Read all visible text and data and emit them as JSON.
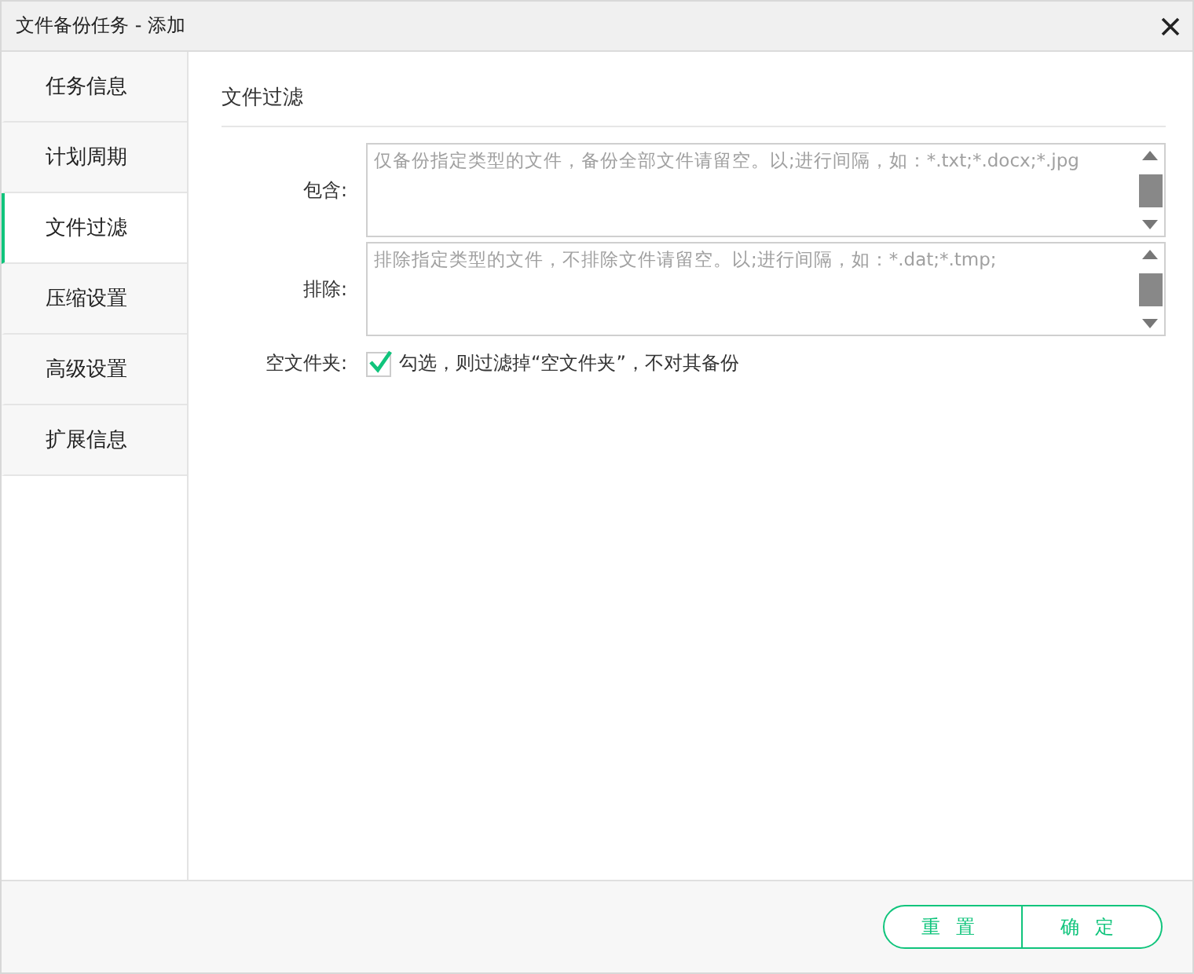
{
  "window": {
    "title": "文件备份任务 - 添加"
  },
  "sidebar": {
    "items": [
      {
        "label": "任务信息",
        "selected": false
      },
      {
        "label": "计划周期",
        "selected": false
      },
      {
        "label": "文件过滤",
        "selected": true
      },
      {
        "label": "压缩设置",
        "selected": false
      },
      {
        "label": "高级设置",
        "selected": false
      },
      {
        "label": "扩展信息",
        "selected": false
      }
    ]
  },
  "section": {
    "title": "文件过滤"
  },
  "fields": [
    {
      "label": "包含:",
      "placeholder": "仅备份指定类型的文件，备份全部文件请留空。以;进行间隔，如：*.txt;*.docx;*.jpg"
    },
    {
      "label": "排除:",
      "placeholder": "排除指定类型的文件，不排除文件请留空。以;进行间隔，如：*.dat;*.tmp;"
    }
  ],
  "empty_folder": {
    "label": "空文件夹:",
    "checked": true,
    "text": "勾选，则过滤掉“空文件夹”，不对其备份"
  },
  "buttons": [
    "重置",
    "确定"
  ]
}
